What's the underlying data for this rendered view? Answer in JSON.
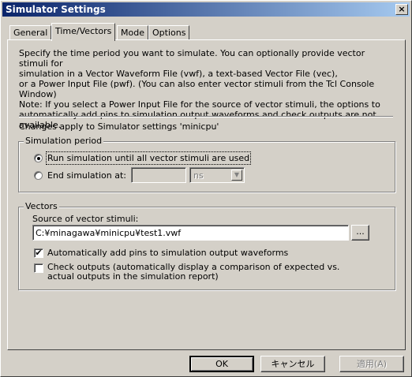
{
  "window": {
    "title": "Simulator Settings",
    "close_label": "×"
  },
  "tabs": [
    {
      "label": "General",
      "active": false
    },
    {
      "label": "Time/Vectors",
      "active": true
    },
    {
      "label": "Mode",
      "active": false
    },
    {
      "label": "Options",
      "active": false
    }
  ],
  "description": {
    "line1": "Specify the time period you want to simulate.  You can optionally provide vector stimuli for",
    "line2": "simulation in a Vector Waveform File (vwf), a text-based Vector File (vec),",
    "line3": "or a Power Input File (pwf). (You can also enter vector stimuli from the Tcl Console",
    "line4": "Window)",
    "line5": "Note: If you select a Power Input File for the source of vector stimuli, the options to",
    "line6": "automatically add pins to simulation output waveforms and check outputs are not available."
  },
  "changes_note": "Changes apply to Simulator settings 'minicpu'",
  "simulation_period": {
    "legend": "Simulation period",
    "option_run_all": "Run simulation until all vector stimuli are used",
    "option_end_at": "End simulation at:",
    "end_time_value": "",
    "end_time_unit": "ns",
    "selected": "run_all"
  },
  "vectors": {
    "legend": "Vectors",
    "source_label": "Source of vector stimuli:",
    "source_value": "C:¥minagawa¥minicpu¥test1.vwf",
    "browse_label": "...",
    "auto_add_pins_label": "Automatically add pins to simulation output waveforms",
    "auto_add_pins_checked": true,
    "check_outputs_line1": "Check outputs (automatically display a comparison of expected vs.",
    "check_outputs_line2": "actual outputs in the simulation report)",
    "check_outputs_checked": false,
    "check_mark": "✔"
  },
  "buttons": {
    "ok": "OK",
    "cancel": "キャンセル",
    "apply": "適用(A)"
  }
}
